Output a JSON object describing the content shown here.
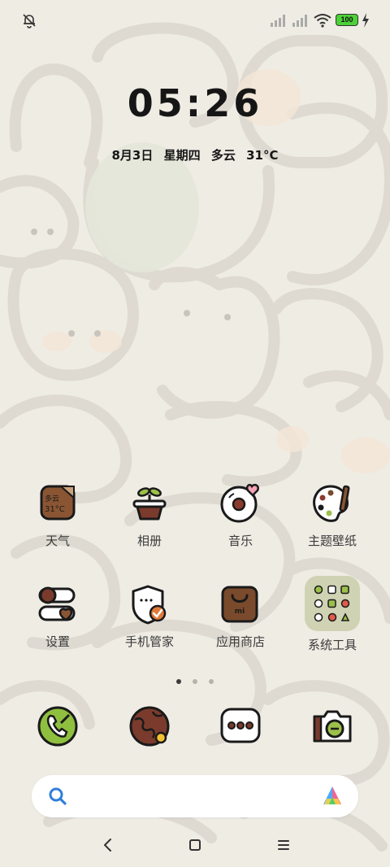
{
  "status_bar": {
    "left_icon": "bell-muted-icon",
    "right_icons": [
      "signal-x-icon",
      "signal-x-icon",
      "wifi-icon"
    ],
    "battery_level": "100",
    "charging_icon": "bolt-icon"
  },
  "clock": {
    "time": "05:26"
  },
  "date_weather": {
    "date": "8月3日",
    "weekday": "星期四",
    "condition": "多云",
    "temperature": "31°C"
  },
  "apps": [
    {
      "label": "天气",
      "icon": "weather-icon",
      "badge_condition": "多云",
      "badge_temp": "31°C"
    },
    {
      "label": "相册",
      "icon": "gallery-plant-icon"
    },
    {
      "label": "音乐",
      "icon": "music-disc-icon"
    },
    {
      "label": "主题壁纸",
      "icon": "palette-icon"
    },
    {
      "label": "设置",
      "icon": "settings-toggle-icon"
    },
    {
      "label": "手机管家",
      "icon": "security-shield-icon"
    },
    {
      "label": "应用商店",
      "icon": "app-store-bag-icon"
    },
    {
      "label": "系统工具",
      "icon": "tools-folder-icon"
    }
  ],
  "page_indicator": {
    "count": 3,
    "active": 0
  },
  "dock": [
    {
      "icon": "phone-icon"
    },
    {
      "icon": "browser-globe-icon"
    },
    {
      "icon": "messages-icon"
    },
    {
      "icon": "camera-icon"
    }
  ],
  "search": {
    "icon": "search-icon",
    "assistant_icon": "assistant-logo-icon"
  },
  "navbar": {
    "back": "back-icon",
    "home": "home-icon",
    "menu": "recents-icon"
  },
  "colors": {
    "icon_brown": "#7a4a2c",
    "search_blue": "#2f7fd9",
    "wall_outline": "#dcd8d0"
  }
}
